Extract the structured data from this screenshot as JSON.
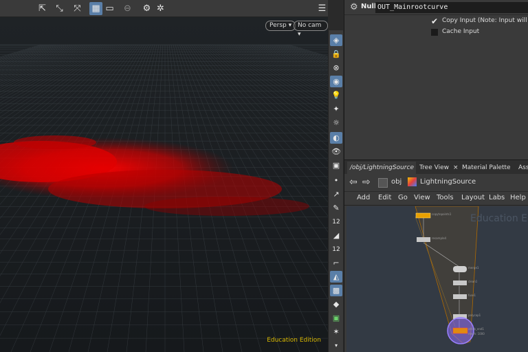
{
  "viewport": {
    "camera_view": "Persp",
    "camera_select": "No cam",
    "watermark": "Education Edition"
  },
  "viewport_toolbar": {
    "icons": [
      "select-tool-icon",
      "transform-tool-icon",
      "handle-tool-icon",
      "display-options-icon",
      "view-tool-icon",
      "disabled-icon",
      "snapshot-icon",
      "asterisk-icon",
      "layout-icon",
      "help-icon"
    ]
  },
  "side_toolbar": {
    "labels": {
      "vertex_count_a": "12",
      "vertex_count_b": "12"
    }
  },
  "params": {
    "node_type": "Null",
    "node_name": "OUT_Mainrootcurve",
    "copy_input_label": "Copy Input (Note: Input will be s",
    "cache_input_label": "Cache Input"
  },
  "network": {
    "tabs": [
      {
        "label": "/obj/LightningSource",
        "close": "×"
      },
      {
        "label": "Tree View",
        "close": "×"
      },
      {
        "label": "Material Palette",
        "close": "×"
      },
      {
        "label": "Asse",
        "close": ""
      }
    ],
    "path": {
      "context": "obj",
      "node": "LightningSource"
    },
    "menu": [
      "Add",
      "Edit",
      "Go",
      "View",
      "Tools",
      "Layout",
      "Labs",
      "Help"
    ],
    "watermark": "Education E",
    "node_labels": [
      "copytopoints1",
      "resample4",
      "merge1",
      "clean1",
      "fuse1",
      "polycap1",
      "attrib_end1",
      "mesh: 1000"
    ]
  },
  "colors": {
    "accent": "#5a7fa8",
    "point_cloud": "#d80000",
    "node_selected": "#e8a000",
    "network_box": "#b06a00",
    "edu_text": "#d8b800"
  }
}
